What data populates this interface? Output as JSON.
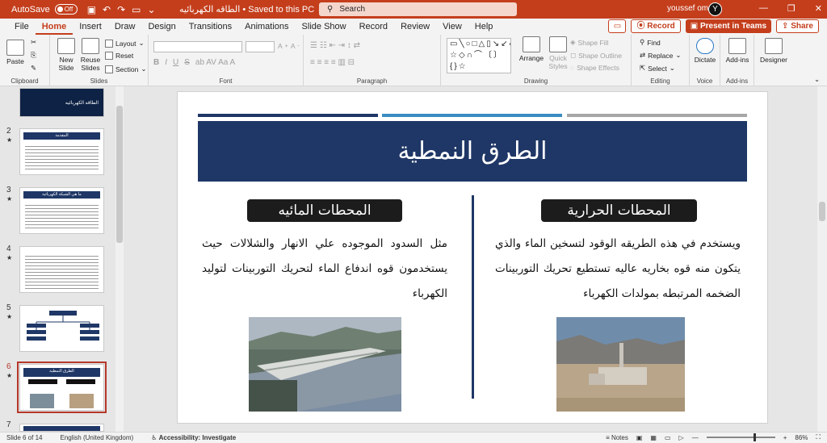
{
  "titlebar": {
    "autosave_label": "AutoSave",
    "autosave_state": "Off",
    "doc_title": "الطاقه الكهربائيه • Saved to this PC ⌄",
    "search_placeholder": "Search",
    "user_name": "youssef omar",
    "avatar_initial": "Y"
  },
  "menu": {
    "tabs": [
      "File",
      "Home",
      "Insert",
      "Draw",
      "Design",
      "Transitions",
      "Animations",
      "Slide Show",
      "Record",
      "Review",
      "View",
      "Help"
    ],
    "active": "Home",
    "record_btn": "Record",
    "teams_btn": "Present in Teams",
    "share_btn": "Share"
  },
  "ribbon": {
    "clipboard": {
      "label": "Clipboard",
      "paste": "Paste"
    },
    "slides": {
      "label": "Slides",
      "new_slide": "New Slide",
      "reuse": "Reuse Slides",
      "layout": "Layout",
      "reset": "Reset",
      "section": "Section"
    },
    "font": {
      "label": "Font"
    },
    "paragraph": {
      "label": "Paragraph"
    },
    "drawing": {
      "label": "Drawing",
      "arrange": "Arrange",
      "quick_styles": "Quick Styles",
      "shape_fill": "Shape Fill",
      "shape_outline": "Shape Outline",
      "shape_effects": "Shape Effects"
    },
    "editing": {
      "label": "Editing",
      "find": "Find",
      "replace": "Replace",
      "select": "Select"
    },
    "voice": {
      "label": "Voice",
      "dictate": "Dictate"
    },
    "addins": {
      "label": "Add-ins",
      "addins_btn": "Add-ins"
    },
    "designer": {
      "designer_btn": "Designer"
    }
  },
  "thumbnails": [
    {
      "num": "",
      "title": "الطاقه الكهربائيه"
    },
    {
      "num": "2",
      "title": "المقدمة"
    },
    {
      "num": "3",
      "title": "ما هي الشبكة الكهربائية"
    },
    {
      "num": "4",
      "title": ""
    },
    {
      "num": "5",
      "title": ""
    },
    {
      "num": "6",
      "title": "الطرق النمطية"
    },
    {
      "num": "7",
      "title": ""
    }
  ],
  "slide": {
    "title": "الطرق النمطية",
    "right_heading": "المحطات الحرارية",
    "left_heading": "المحطات المائيه",
    "right_text": "ويستخدم في هذه الطريقه الوقود لتسخين الماء والذي يتكون منه قوه بخاريه عاليه تستطيع تحريك التوربينات الضخمه المرتبطه بمولدات الكهرباء",
    "left_text": "مثل السدود الموجوده علي الانهار والشلالات حيث يستخدمون قوه اندفاع الماء لتحريك التوربينات لتوليد الكهرباء"
  },
  "status": {
    "slide_count": "Slide 6 of 14",
    "language": "English (United Kingdom)",
    "accessibility": "Accessibility: Investigate",
    "notes": "Notes",
    "zoom": "86%"
  },
  "colors": {
    "accent": "#c43e1c",
    "navy": "#1f3766",
    "blue": "#3a8cc1"
  }
}
